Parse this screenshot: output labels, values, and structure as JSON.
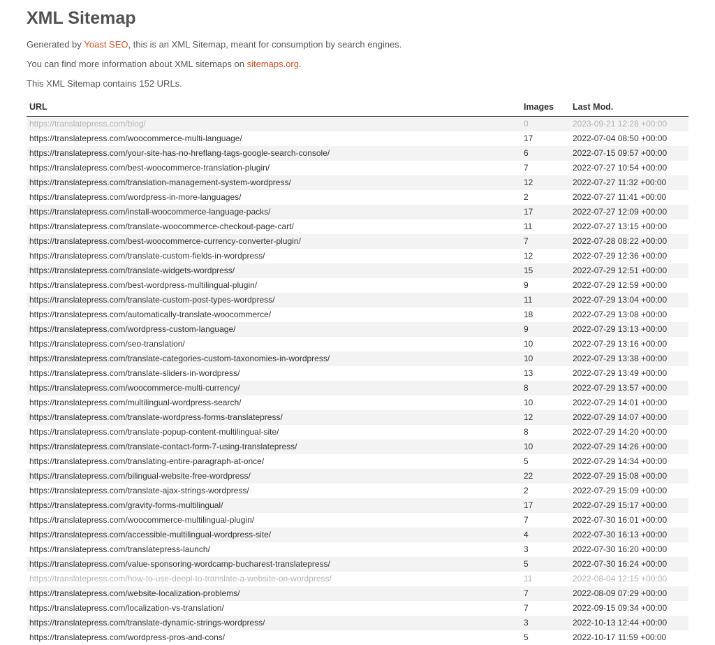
{
  "title": "XML Sitemap",
  "intro1_prefix": "Generated by ",
  "intro1_link": "Yoast SEO",
  "intro1_suffix": ", this is an XML Sitemap, meant for consumption by search engines.",
  "intro2_prefix": "You can find more information about XML sitemaps on ",
  "intro2_link": "sitemaps.org",
  "intro2_suffix": ".",
  "intro3": "This XML Sitemap contains 152 URLs.",
  "headers": {
    "url": "URL",
    "images": "Images",
    "lastmod": "Last Mod."
  },
  "rows": [
    {
      "url": "https://translatepress.com/blog/",
      "images": "0",
      "lastmod": "2023-09-21 12:28 +00:00",
      "muted": true
    },
    {
      "url": "https://translatepress.com/woocommerce-multi-language/",
      "images": "17",
      "lastmod": "2022-07-04 08:50 +00:00"
    },
    {
      "url": "https://translatepress.com/your-site-has-no-hreflang-tags-google-search-console/",
      "images": "6",
      "lastmod": "2022-07-15 09:57 +00:00"
    },
    {
      "url": "https://translatepress.com/best-woocommerce-translation-plugin/",
      "images": "7",
      "lastmod": "2022-07-27 10:54 +00:00"
    },
    {
      "url": "https://translatepress.com/translation-management-system-wordpress/",
      "images": "12",
      "lastmod": "2022-07-27 11:32 +00:00"
    },
    {
      "url": "https://translatepress.com/wordpress-in-more-languages/",
      "images": "2",
      "lastmod": "2022-07-27 11:41 +00:00"
    },
    {
      "url": "https://translatepress.com/install-woocommerce-language-packs/",
      "images": "17",
      "lastmod": "2022-07-27 12:09 +00:00"
    },
    {
      "url": "https://translatepress.com/translate-woocommerce-checkout-page-cart/",
      "images": "11",
      "lastmod": "2022-07-27 13:15 +00:00"
    },
    {
      "url": "https://translatepress.com/best-woocommerce-currency-converter-plugin/",
      "images": "7",
      "lastmod": "2022-07-28 08:22 +00:00"
    },
    {
      "url": "https://translatepress.com/translate-custom-fields-in-wordpress/",
      "images": "12",
      "lastmod": "2022-07-29 12:36 +00:00"
    },
    {
      "url": "https://translatepress.com/translate-widgets-wordpress/",
      "images": "15",
      "lastmod": "2022-07-29 12:51 +00:00"
    },
    {
      "url": "https://translatepress.com/best-wordpress-multilingual-plugin/",
      "images": "9",
      "lastmod": "2022-07-29 12:59 +00:00"
    },
    {
      "url": "https://translatepress.com/translate-custom-post-types-wordpress/",
      "images": "11",
      "lastmod": "2022-07-29 13:04 +00:00"
    },
    {
      "url": "https://translatepress.com/automatically-translate-woocommerce/",
      "images": "18",
      "lastmod": "2022-07-29 13:08 +00:00"
    },
    {
      "url": "https://translatepress.com/wordpress-custom-language/",
      "images": "9",
      "lastmod": "2022-07-29 13:13 +00:00"
    },
    {
      "url": "https://translatepress.com/seo-translation/",
      "images": "10",
      "lastmod": "2022-07-29 13:16 +00:00"
    },
    {
      "url": "https://translatepress.com/translate-categories-custom-taxonomies-in-wordpress/",
      "images": "10",
      "lastmod": "2022-07-29 13:38 +00:00"
    },
    {
      "url": "https://translatepress.com/translate-sliders-in-wordpress/",
      "images": "13",
      "lastmod": "2022-07-29 13:49 +00:00"
    },
    {
      "url": "https://translatepress.com/woocommerce-multi-currency/",
      "images": "8",
      "lastmod": "2022-07-29 13:57 +00:00"
    },
    {
      "url": "https://translatepress.com/multilingual-wordpress-search/",
      "images": "10",
      "lastmod": "2022-07-29 14:01 +00:00"
    },
    {
      "url": "https://translatepress.com/translate-wordpress-forms-translatepress/",
      "images": "12",
      "lastmod": "2022-07-29 14:07 +00:00"
    },
    {
      "url": "https://translatepress.com/translate-popup-content-multilingual-site/",
      "images": "8",
      "lastmod": "2022-07-29 14:20 +00:00"
    },
    {
      "url": "https://translatepress.com/translate-contact-form-7-using-translatepress/",
      "images": "10",
      "lastmod": "2022-07-29 14:26 +00:00"
    },
    {
      "url": "https://translatepress.com/translating-entire-paragraph-at-once/",
      "images": "5",
      "lastmod": "2022-07-29 14:34 +00:00"
    },
    {
      "url": "https://translatepress.com/bilingual-website-free-wordpress/",
      "images": "22",
      "lastmod": "2022-07-29 15:08 +00:00"
    },
    {
      "url": "https://translatepress.com/translate-ajax-strings-wordpress/",
      "images": "2",
      "lastmod": "2022-07-29 15:09 +00:00"
    },
    {
      "url": "https://translatepress.com/gravity-forms-multilingual/",
      "images": "17",
      "lastmod": "2022-07-29 15:17 +00:00"
    },
    {
      "url": "https://translatepress.com/woocommerce-multilingual-plugin/",
      "images": "7",
      "lastmod": "2022-07-30 16:01 +00:00"
    },
    {
      "url": "https://translatepress.com/accessible-multilingual-wordpress-site/",
      "images": "4",
      "lastmod": "2022-07-30 16:13 +00:00"
    },
    {
      "url": "https://translatepress.com/translatepress-launch/",
      "images": "3",
      "lastmod": "2022-07-30 16:20 +00:00"
    },
    {
      "url": "https://translatepress.com/value-sponsoring-wordcamp-bucharest-translatepress/",
      "images": "5",
      "lastmod": "2022-07-30 16:24 +00:00"
    },
    {
      "url": "https://translatepress.com/how-to-use-deepl-to-translate-a-website-on-wordpress/",
      "images": "11",
      "lastmod": "2022-08-04 12:15 +00:00",
      "muted": true
    },
    {
      "url": "https://translatepress.com/website-localization-problems/",
      "images": "7",
      "lastmod": "2022-08-09 07:29 +00:00"
    },
    {
      "url": "https://translatepress.com/localization-vs-translation/",
      "images": "7",
      "lastmod": "2022-09-15 09:34 +00:00"
    },
    {
      "url": "https://translatepress.com/translate-dynamic-strings-wordpress/",
      "images": "3",
      "lastmod": "2022-10-13 12:44 +00:00"
    },
    {
      "url": "https://translatepress.com/wordpress-pros-and-cons/",
      "images": "5",
      "lastmod": "2022-10-17 11:59 +00:00"
    }
  ]
}
